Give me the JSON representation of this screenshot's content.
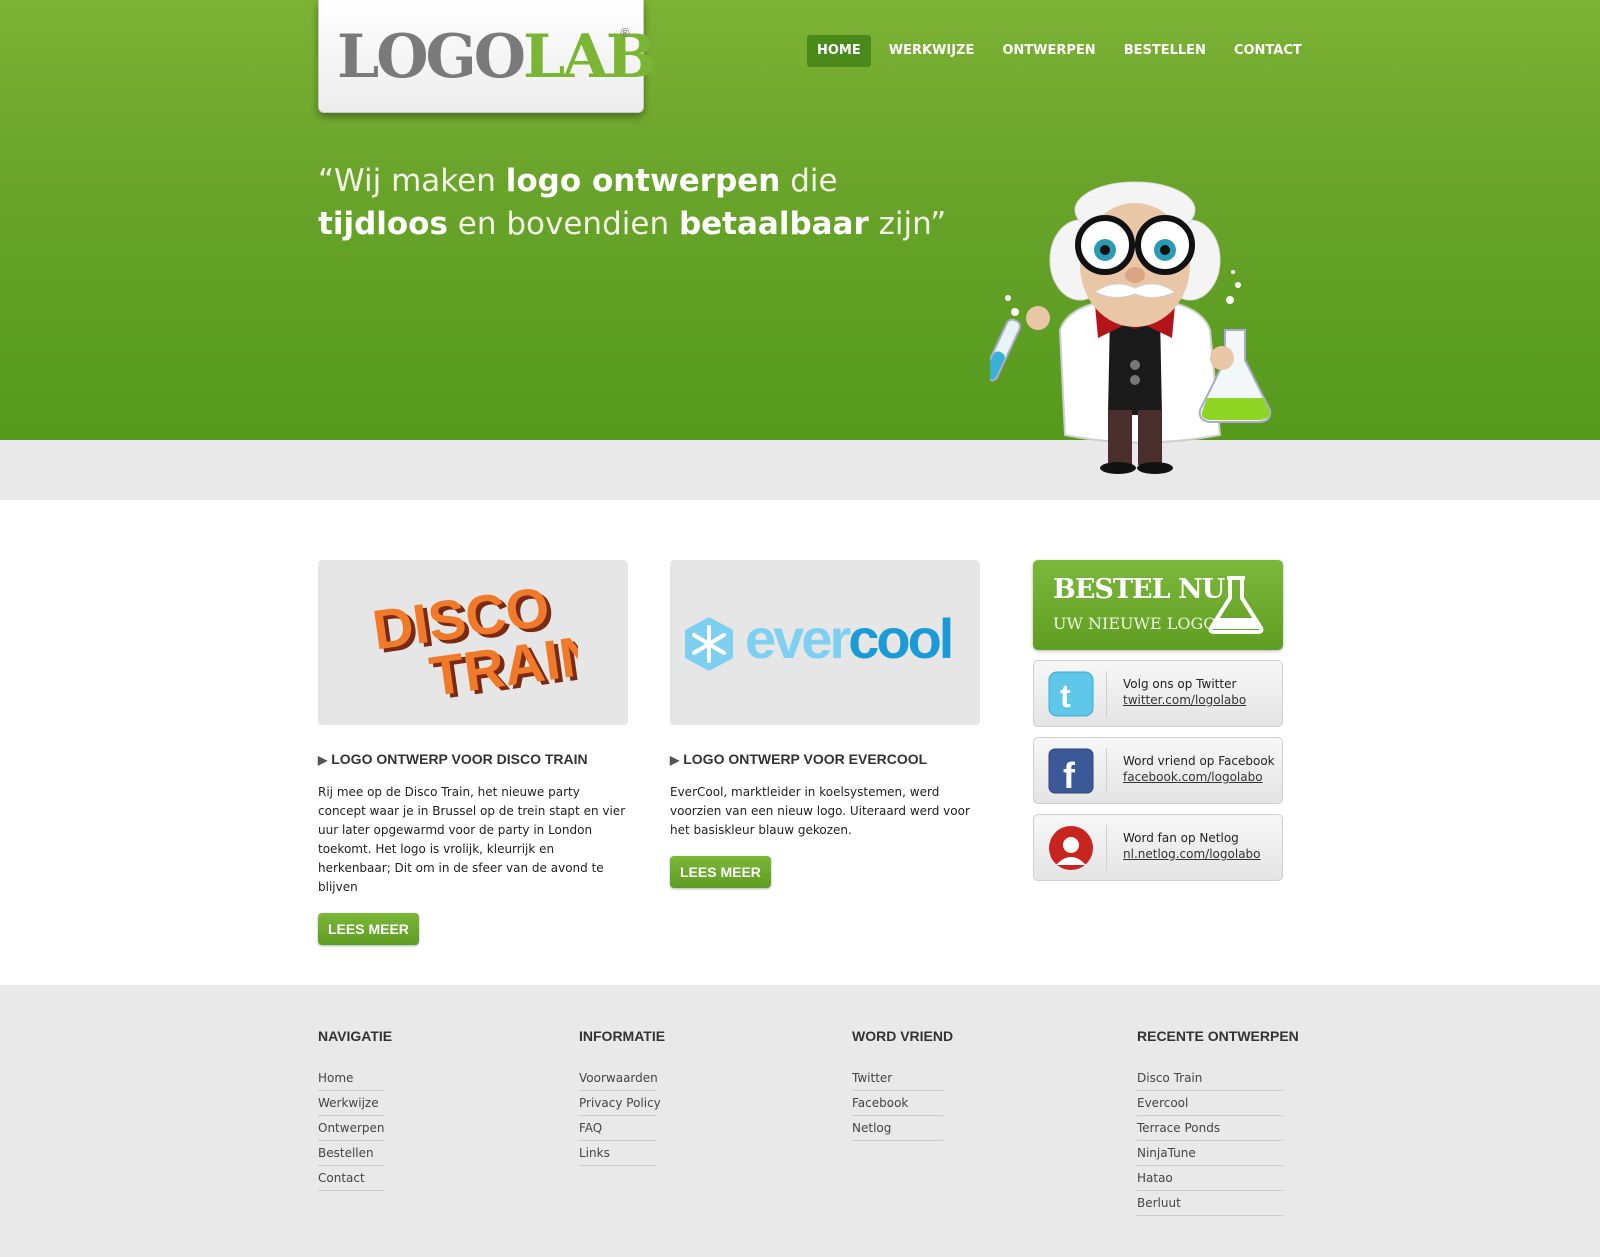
{
  "logo": {
    "part1": "LOGO",
    "part2": "LAB",
    "registered": "®"
  },
  "nav": {
    "items": [
      {
        "label": "HOME",
        "active": true
      },
      {
        "label": "WERKWIJZE",
        "active": false
      },
      {
        "label": "ONTWERPEN",
        "active": false
      },
      {
        "label": "BESTELLEN",
        "active": false
      },
      {
        "label": "CONTACT",
        "active": false
      }
    ]
  },
  "hero": {
    "line1_a": "“Wij maken ",
    "line1_b": "logo ontwerpen",
    "line1_c": " die",
    "line2_a": "tijdloos",
    "line2_b": " en bovendien ",
    "line2_c": "betaalbaar",
    "line2_d": " zijn”"
  },
  "cards": [
    {
      "image_text_1": "DISCO",
      "image_text_2": "TRAIN",
      "title": "LOGO ONTWERP VOOR DISCO TRAIN",
      "text": "Rij mee op de Disco Train, het nieuwe party concept waar je in Brussel op de trein stapt en vier uur later opgewarmd voor de party in London toekomt. Het logo is vrolijk, kleurrijk en herkenbaar; Dit om in de sfeer van de avond te blijven",
      "button": "LEES MEER"
    },
    {
      "image_text_1": "ever",
      "image_text_2": "cool",
      "title": "LOGO ONTWERP VOOR EVERCOOL",
      "text": "EverCool, marktleider in koelsystemen, werd voorzien van een nieuw logo. Uiteraard werd voor het basiskleur blauw gekozen.",
      "button": "LEES MEER"
    }
  ],
  "order": {
    "title": "BESTEL NU",
    "subtitle": "UW NIEUWE LOGO"
  },
  "social": [
    {
      "icon": "twitter-icon",
      "label": "Volg ons op Twitter",
      "link": "twitter.com/logolabo"
    },
    {
      "icon": "facebook-icon",
      "label": "Word vriend op Facebook",
      "link": "facebook.com/logolabo"
    },
    {
      "icon": "netlog-icon",
      "label": "Word fan op Netlog",
      "link": "nl.netlog.com/logolabo"
    }
  ],
  "footer": {
    "navigatie": {
      "title": "NAVIGATIE",
      "items": [
        "Home",
        "Werkwijze",
        "Ontwerpen",
        "Bestellen",
        "Contact"
      ]
    },
    "informatie": {
      "title": "INFORMATIE",
      "items": [
        "Voorwaarden",
        "Privacy Policy",
        "FAQ",
        "Links"
      ]
    },
    "vriend": {
      "title": "WORD VRIEND",
      "items": [
        "Twitter",
        "Facebook",
        "Netlog"
      ]
    },
    "recent": {
      "title": "RECENTE ONTWERPEN",
      "items": [
        "Disco Train",
        "Evercool",
        "Terrace Ponds",
        "NinjaTune",
        "Hatao",
        "Berluut"
      ]
    }
  },
  "colors": {
    "green": "#6aa42b",
    "dark_green": "#4a8a1b",
    "light_gray": "#e9e9e9",
    "evercool_blue": "#1a9ad6",
    "disco_orange": "#f07a2a"
  }
}
